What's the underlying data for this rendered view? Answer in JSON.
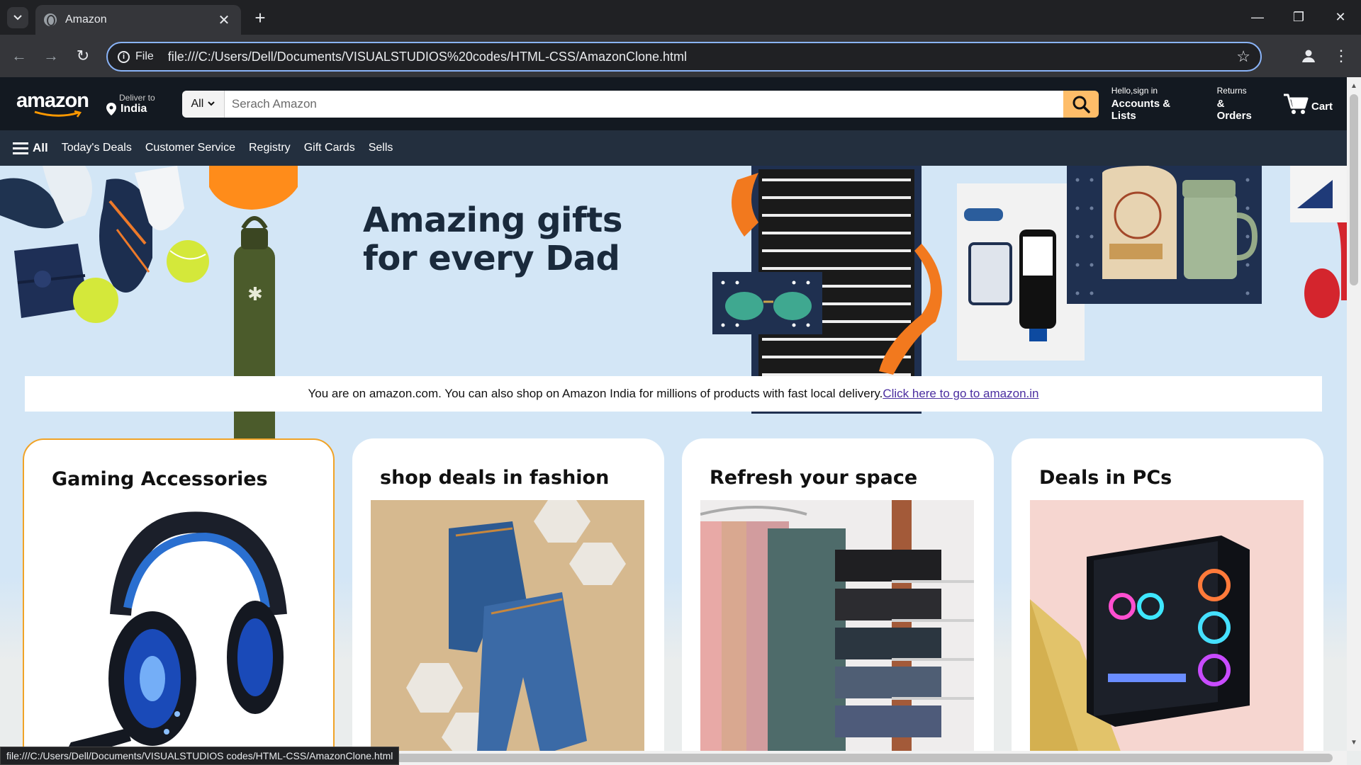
{
  "browser": {
    "tab_title": "Amazon",
    "omnibox_label": "File",
    "url": "file:///C:/Users/Dell/Documents/VISUALSTUDIOS%20codes/HTML-CSS/AmazonClone.html",
    "status_url": "file:///C:/Users/Dell/Documents/VISUALSTUDIOS codes/HTML-CSS/AmazonClone.html"
  },
  "header": {
    "logo_text": "amazon",
    "deliver_line1": "Deliver to",
    "deliver_line2": "India",
    "search_category": "All",
    "search_placeholder": "Serach Amazon",
    "account_line1": "Hello,sign in",
    "account_line2": "Accounts & Lists",
    "returns_line1": "Returns",
    "returns_line2": "& Orders",
    "cart_label": "Cart"
  },
  "nav": {
    "all_label": "All",
    "items": [
      "Today's Deals",
      "Customer Service",
      "Registry",
      "Gift Cards",
      "Sells"
    ]
  },
  "hero": {
    "title_line1": "Amazing gifts",
    "title_line2": "for every Dad"
  },
  "notice": {
    "text": "You are on amazon.com. You can also shop on Amazon India for millions of products with fast local delivery.",
    "link": "Click here to go to amazon.in"
  },
  "cards": [
    {
      "title": "Gaming Accessories"
    },
    {
      "title": "shop deals in fashion"
    },
    {
      "title": "Refresh your space"
    },
    {
      "title": "Deals in PCs"
    }
  ],
  "colors": {
    "header_bg": "#131921",
    "nav_bg": "#232f3e",
    "search_button": "#febd69",
    "hero_bg": "#d3e6f6",
    "card_highlight_border": "#f0a327"
  }
}
